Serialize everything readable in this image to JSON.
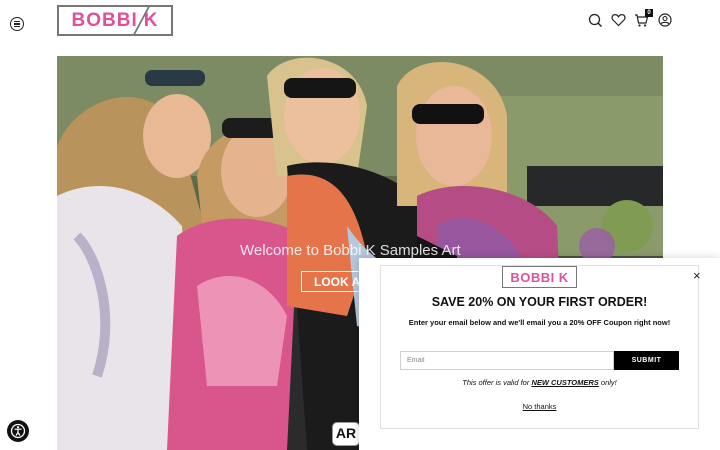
{
  "header": {
    "logo_text": "BOBBI",
    "logo_letter": "K",
    "cart_count": "0",
    "brand_color": "#e0509a",
    "icons": [
      "menu-icon",
      "search-icon",
      "heart-icon",
      "cart-icon",
      "user-icon"
    ]
  },
  "hero": {
    "title": "Welcome to Bobbi K Samples Art",
    "button_label": "LOOK AT",
    "badge_text": "AR"
  },
  "popup": {
    "logo_text": "BOBBI",
    "logo_letter": "K",
    "close_label": "×",
    "title": "SAVE 20% ON YOUR FIRST ORDER!",
    "subtitle": "Enter your email below and we'll email you a 20% OFF Coupon right now!",
    "email_placeholder": "Email",
    "submit_label": "SUBMIT",
    "note_prefix": "This offer is valid for ",
    "note_emphasis": "NEW CUSTOMERS",
    "note_suffix": " only!",
    "no_thanks_label": "No thanks"
  },
  "accessibility": {
    "icon": "accessibility-icon"
  }
}
